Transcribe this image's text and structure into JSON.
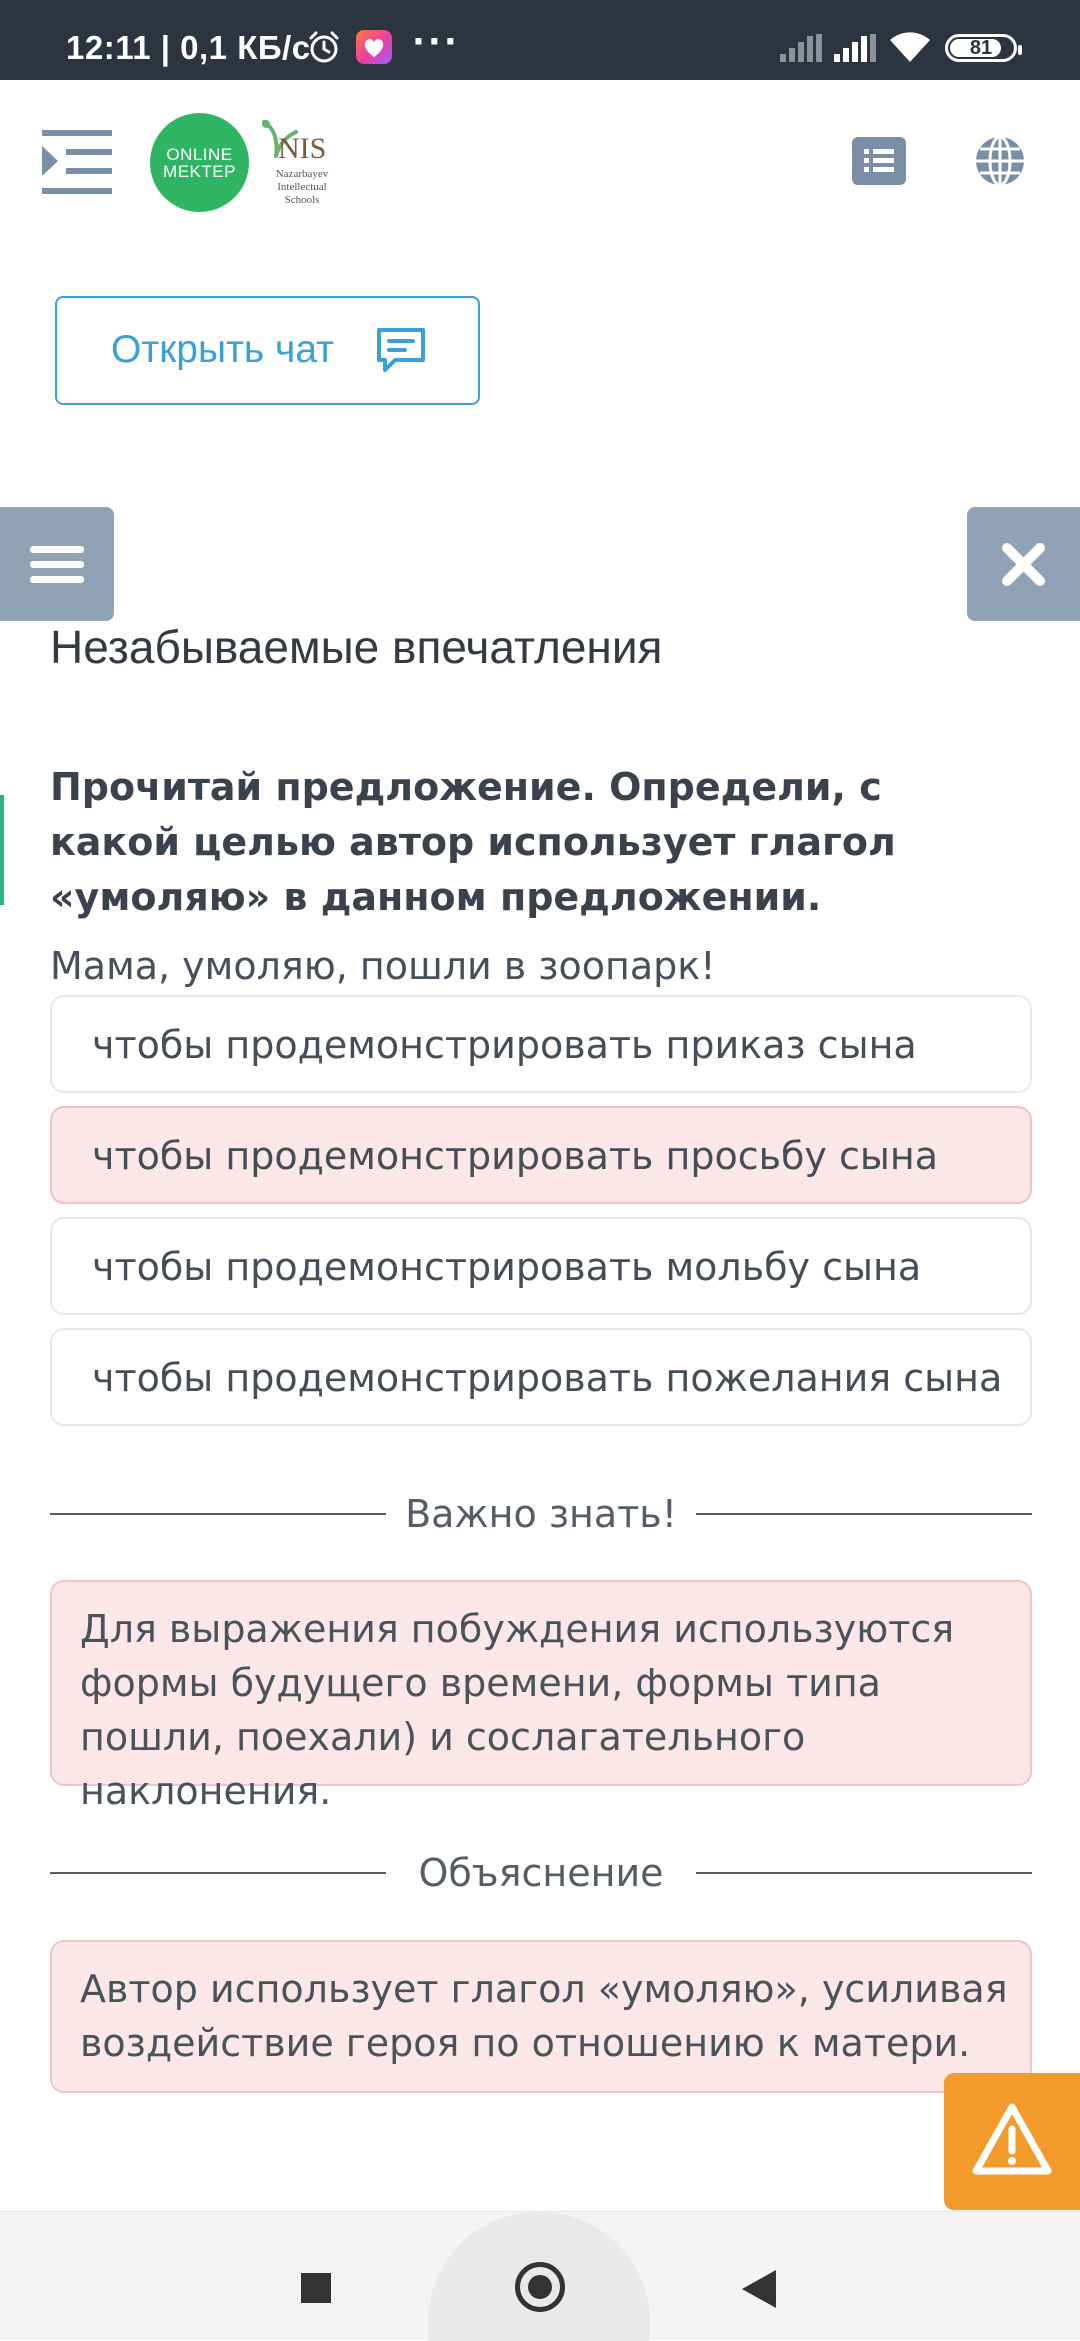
{
  "status_bar": {
    "time": "12:11 | 0,1 КБ/с",
    "dots": "···",
    "battery": "81"
  },
  "header": {
    "logo_online_line1": "ONLINE",
    "logo_online_line2": "MEKTEP",
    "logo_nis_title": "NIS",
    "logo_nis_subtitle": "Nazarbayev Intellectual Schools"
  },
  "chat_button": {
    "label": "Открыть чат"
  },
  "lesson": {
    "title": "Незабываемые впечатления",
    "question": "Прочитай предложение. Определи, с какой целью автор использует глагол «умоляю» в данном предложении.",
    "sentence": "Мама, умоляю, пошли в зоопарк!",
    "options": [
      {
        "text": "чтобы продемонстрировать приказ сына",
        "selected": false
      },
      {
        "text": "чтобы продемонстрировать просьбу сына",
        "selected": true
      },
      {
        "text": "чтобы продемонстрировать мольбу сына",
        "selected": false
      },
      {
        "text": "чтобы продемонстрировать пожелания сына",
        "selected": false
      }
    ]
  },
  "important": {
    "heading": "Важно знать!",
    "text": "Для выражения побуждения используются формы будущего времени, формы типа пошли, поехали) и сослагательного наклонения."
  },
  "explanation": {
    "heading": "Объяснение",
    "text": "Автор использует глагол «умоляю», усиливая воздействие героя по отношению к матери."
  },
  "colors": {
    "status_bar_bg": "#2c3440",
    "accent_blue": "#3aa0da",
    "online_mektep_green": "#2fb464",
    "selected_option_bg": "#fbe7e7",
    "float_button_bg": "#8fa3b5",
    "warning_orange": "#f39a2d"
  }
}
